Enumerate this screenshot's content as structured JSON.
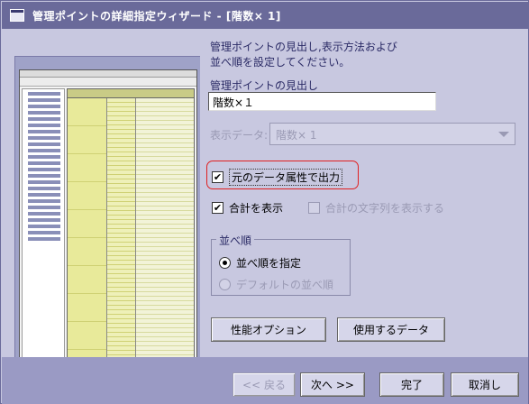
{
  "window": {
    "title": "管理ポイントの詳細指定ウィザード - [階数× 1]"
  },
  "description": {
    "line1": "管理ポイントの見出し,表示方法および",
    "line2": "並べ順を設定してください。"
  },
  "heading_field": {
    "label": "管理ポイントの見出し",
    "value": "階数×１"
  },
  "display_data": {
    "label": "表示データ:",
    "selected": "階数× 1"
  },
  "checkboxes": {
    "original_attr": {
      "label": "元のデータ属性で出力",
      "checked": true
    },
    "show_total": {
      "label": "合計を表示",
      "checked": true
    },
    "show_total_text": {
      "label": "合計の文字列を表示する",
      "checked": false
    }
  },
  "sort_group": {
    "title": "並べ順",
    "option_specify": "並べ順を指定",
    "option_default": "デフォルトの並べ順"
  },
  "buttons": {
    "performance": "性能オプション",
    "used_data": "使用するデータ",
    "back": "<< 戻る",
    "next": "次へ >>",
    "finish": "完了",
    "cancel": "取消し"
  },
  "colors": {
    "window_bg": "#c8c8e0",
    "titlebar_bg": "#6a6a9a",
    "highlight": "#e02020",
    "label_text": "#2b2b66",
    "disabled_text": "#9a9ab4"
  },
  "icons": {
    "title": "window-icon"
  }
}
